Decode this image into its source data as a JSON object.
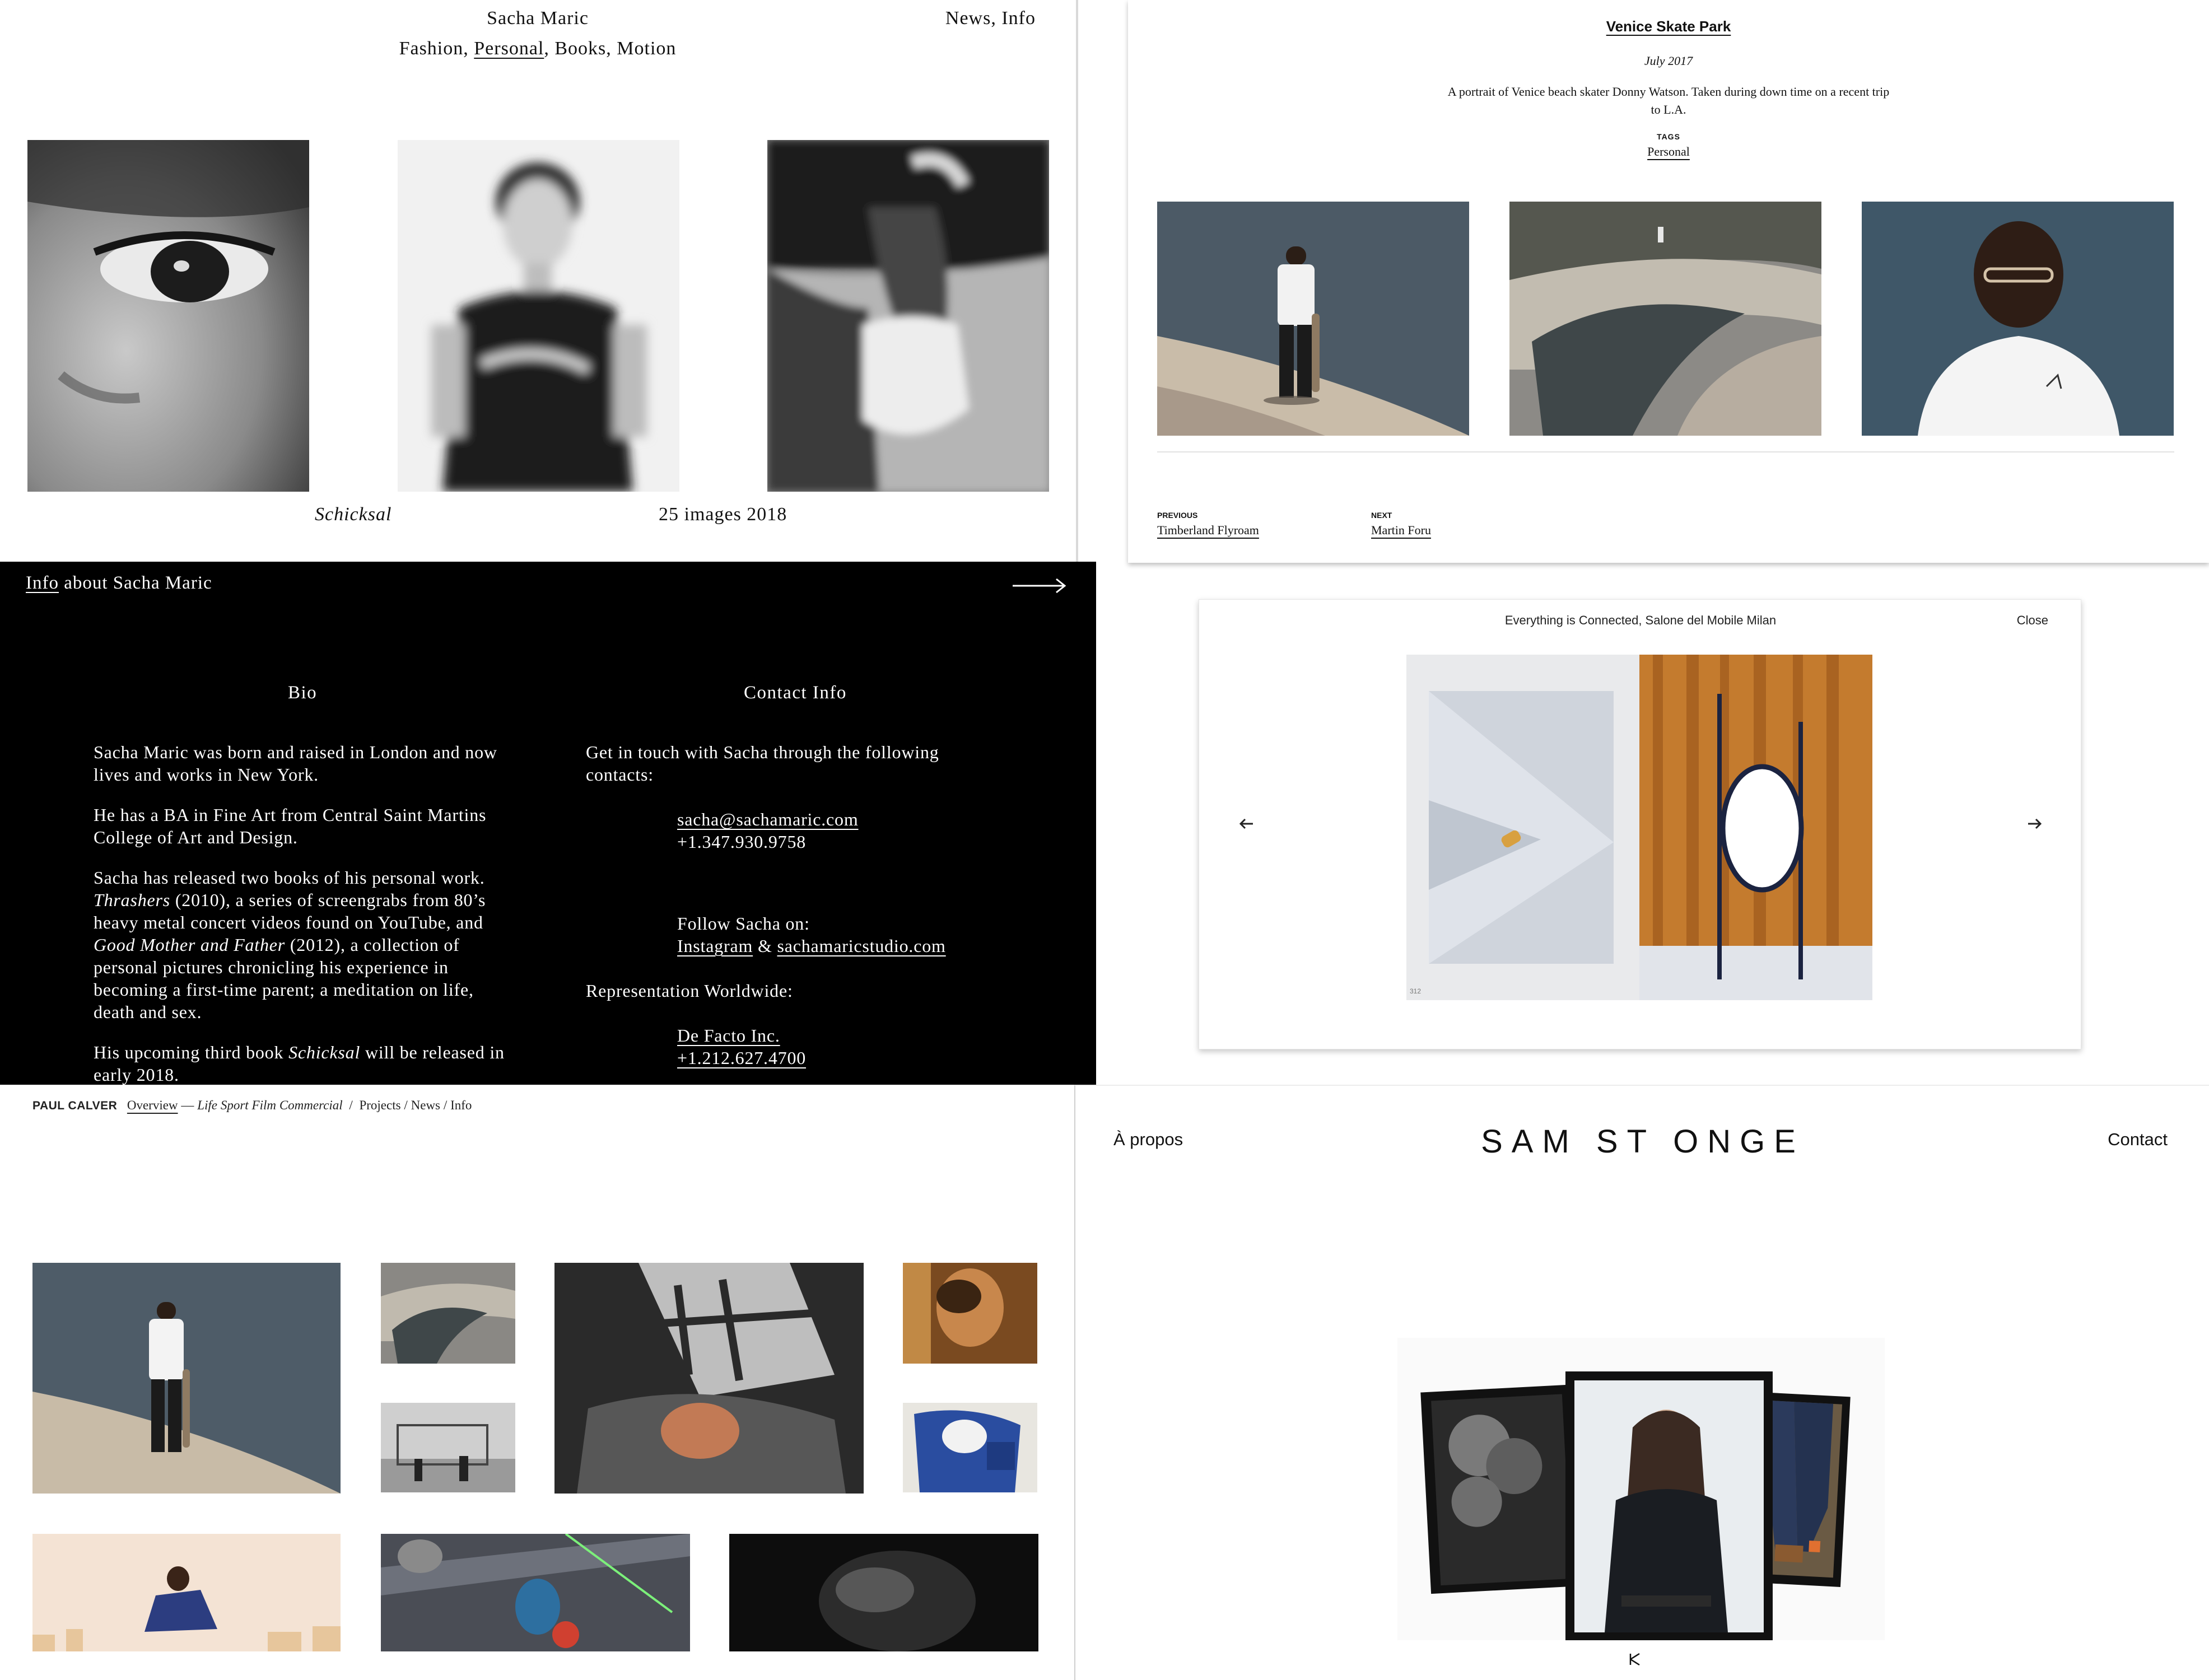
{
  "sacha_gallery": {
    "site_name": "Sacha Maric",
    "nav": {
      "fashion": "Fashion",
      "personal": "Personal",
      "books": "Books",
      "motion": "Motion"
    },
    "right_links": {
      "news": "News",
      "info": "Info"
    },
    "caption_title": "Schicksal",
    "caption_count": "25 images 2018"
  },
  "venice": {
    "title": "Venice Skate Park",
    "date": "July 2017",
    "description": "A portrait of Venice beach skater Donny Watson. Taken during down time on a recent trip to L.A.",
    "tags_heading": "TAGS",
    "tag": "Personal",
    "previous_label": "PREVIOUS",
    "previous_link": "Timberland Flyroam",
    "next_label": "NEXT",
    "next_link": "Martin Foru"
  },
  "info_panel": {
    "header_link": "Info",
    "header_rest": "about Sacha Maric",
    "bio_heading": "Bio",
    "bio_p1": "Sacha Maric was born and raised in London and now lives and works in New York.",
    "bio_p2": "He has a BA in Fine Art from Central Saint Martins College of Art and Design.",
    "bio_p3_a": "Sacha has released two books of his personal work.",
    "bio_p3_book1": "Thrashers",
    "bio_p3_b": "(2010), a series of screengrabs from 80’s heavy metal concert videos found on YouTube, and",
    "bio_p3_book2": "Good Mother and Father",
    "bio_p3_c": "(2012), a collection of personal pictures chronicling his experience in becoming a first-time parent; a meditation on life, death and sex.",
    "bio_p4_a": "His upcoming third book",
    "bio_p4_book": "Schicksal",
    "bio_p4_b": "will be released in early 2018.",
    "contact_heading": "Contact Info",
    "contact_intro": "Get in touch with Sacha through the following contacts:",
    "email": "sacha@sachamaric.com",
    "phone": "+1.347.930.9758",
    "follow": "Follow Sacha on:",
    "instagram": "Instagram",
    "amp": "&",
    "studio_site": "sachamaricstudio.com",
    "representation": "Representation Worldwide:",
    "agency": "De Facto Inc.",
    "agency_phone": "+1.212.627.4700"
  },
  "lightbox": {
    "title": "Everything is Connected, Salone del Mobile Milan",
    "close": "Close",
    "page_number": "312"
  },
  "paul_calver": {
    "brand": "PAUL CALVER",
    "overview": "Overview",
    "dash": "—",
    "categories": [
      "Life",
      "Sport",
      "Film",
      "Commercial"
    ],
    "sep": "/",
    "projects": "Projects",
    "news": "News",
    "info": "Info"
  },
  "sam_st_onge": {
    "apropos": "À propos",
    "logo": "SAM ST ONGE",
    "contact": "Contact"
  },
  "colors": {
    "accent_black": "#000000",
    "panel_white": "#ffffff",
    "link_underline": "#111111"
  }
}
